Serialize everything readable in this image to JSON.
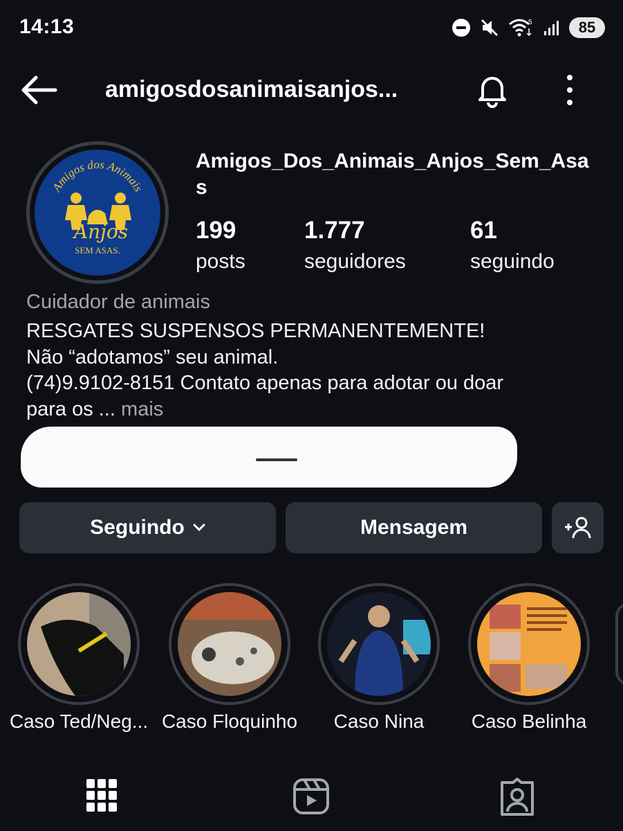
{
  "status_bar": {
    "time": "14:13",
    "battery": "85",
    "icons": [
      "do-not-disturb-icon",
      "muted-icon",
      "wifi-icon",
      "signal-icon"
    ]
  },
  "header": {
    "title": "amigosdosanimaisanjos...",
    "back_icon": "arrow-left-icon",
    "bell_icon": "bell-icon",
    "more_icon": "more-vertical-icon"
  },
  "profile": {
    "avatar_logo": {
      "line1": "Amigos dos Animais",
      "line2": "Anjos",
      "line3": "SEM ASAS."
    },
    "username": "Amigos_Dos_Animais_Anjos_Sem_Asas",
    "stats": [
      {
        "value": "199",
        "label": "posts"
      },
      {
        "value": "1.777",
        "label": "seguidores"
      },
      {
        "value": "61",
        "label": "seguindo"
      }
    ],
    "category": "Cuidador de animais",
    "bio_lines": [
      "RESGATES SUSPENSOS PERMANENTEMENTE!",
      "Não “adotamos” seu animal.",
      "(74)9.9102-8151 Contato apenas para adotar ou doar",
      "para os ..."
    ],
    "bio_more": "mais"
  },
  "actions": {
    "following_label": "Seguindo",
    "message_label": "Mensagem",
    "add_icon": "add-person-icon"
  },
  "highlights": [
    {
      "label": "Caso Ted/Neg..."
    },
    {
      "label": "Caso Floquinho"
    },
    {
      "label": "Caso Nina"
    },
    {
      "label": "Caso Belinha"
    }
  ],
  "tabs": [
    {
      "icon": "grid-icon"
    },
    {
      "icon": "reels-icon"
    },
    {
      "icon": "tagged-icon"
    }
  ],
  "colors": {
    "background": "#0d0f14",
    "button": "#2b2f37",
    "muted_text": "#a3a6ad",
    "avatar_blue": "#0e3b8c",
    "logo_yellow": "#f2c533"
  }
}
